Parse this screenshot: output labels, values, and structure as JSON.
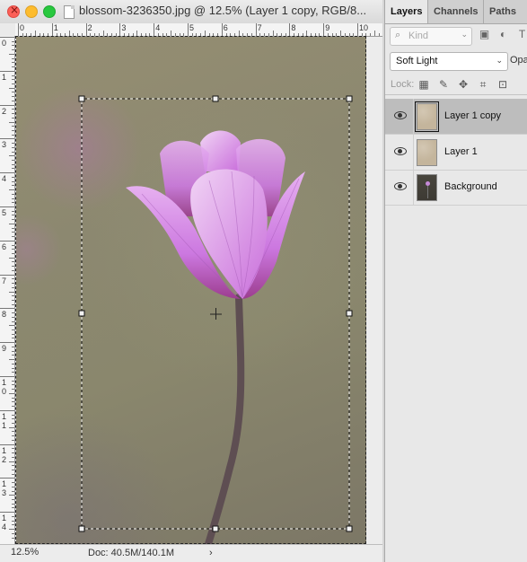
{
  "document": {
    "title": "blossom-3236350.jpg @ 12.5% (Layer 1 copy, RGB/8...",
    "ruler_h_labels": [
      "0",
      "1",
      "2",
      "3",
      "4",
      "5",
      "6",
      "7",
      "8",
      "9",
      "10"
    ],
    "ruler_v_labels": [
      "0",
      "1",
      "2",
      "3",
      "4",
      "5",
      "6",
      "7",
      "8",
      "9",
      "1\n0",
      "1\n1",
      "1\n2",
      "1\n3",
      "1\n4"
    ],
    "zoom": "12.5%",
    "doc_size": "Doc: 40.5M/140.1M",
    "status_arrow": "›",
    "icons": [
      "close-icon",
      "minimize-icon",
      "maximize-icon",
      "document-icon",
      "crosshair-icon"
    ]
  },
  "panel": {
    "tabs": [
      "Layers",
      "Channels",
      "Paths"
    ],
    "active_tab": "Layers",
    "kind_placeholder": "Kind",
    "blend_mode": "Soft Light",
    "opacity_label": "Opa",
    "lock_label": "Lock:",
    "layers": [
      {
        "name": "Layer 1 copy",
        "visible": true,
        "selected": true
      },
      {
        "name": "Layer 1",
        "visible": true,
        "selected": false
      },
      {
        "name": "Background",
        "visible": true,
        "selected": false
      }
    ],
    "filter_icons": [
      "image-filter-icon",
      "adjustment-filter-icon",
      "type-filter-icon"
    ],
    "lock_icons": [
      "lock-transparent-icon",
      "lock-image-icon",
      "lock-position-icon",
      "lock-artboard-icon",
      "lock-all-icon"
    ]
  },
  "colors": {
    "selection": "#bdbdbd",
    "petal": "#d88be8"
  }
}
